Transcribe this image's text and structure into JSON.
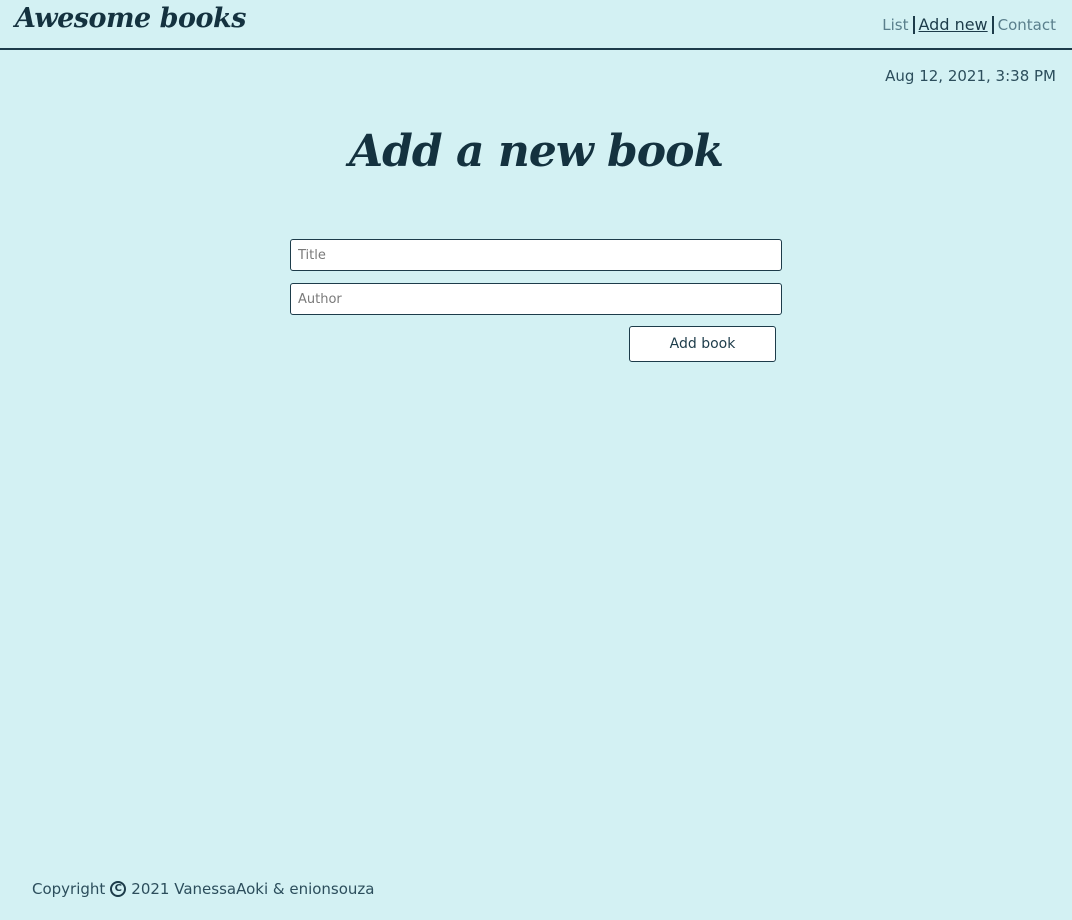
{
  "header": {
    "logo": "Awesome books",
    "nav": {
      "list": "List",
      "add_new": "Add new",
      "contact": "Contact"
    }
  },
  "datetime": "Aug 12, 2021, 3:38 PM",
  "main": {
    "title": "Add a new book",
    "form": {
      "title_placeholder": "Title",
      "title_value": "",
      "author_placeholder": "Author",
      "author_value": "",
      "submit_label": "Add book"
    }
  },
  "footer": {
    "prefix": "Copyright",
    "icon": "copyright-icon",
    "text": "2021 VanessaAoki & enionsouza"
  },
  "colors": {
    "background": "#d3f1f3",
    "primary": "#1d3c4a",
    "nav_inactive": "#5a7f8c"
  }
}
